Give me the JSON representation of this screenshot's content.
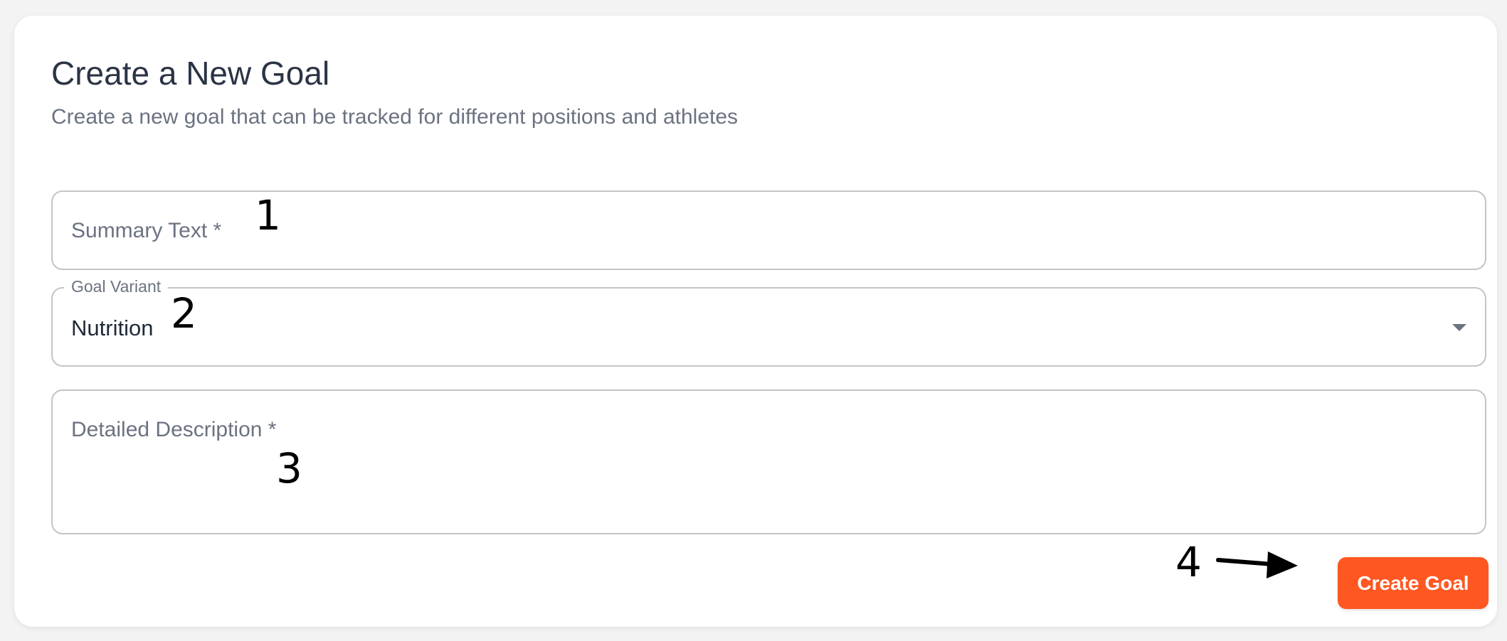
{
  "header": {
    "title": "Create a New Goal",
    "subtitle": "Create a new goal that can be tracked for different positions and athletes"
  },
  "form": {
    "summary": {
      "placeholder": "Summary Text *",
      "value": ""
    },
    "variant": {
      "label": "Goal Variant",
      "value": "Nutrition",
      "icon": "chevron-down-icon"
    },
    "description": {
      "placeholder": "Detailed Description *",
      "value": ""
    },
    "submit_label": "Create Goal"
  },
  "annotations": {
    "n1": "1",
    "n2": "2",
    "n3": "3",
    "n4": "4"
  },
  "colors": {
    "accent": "#fe5722",
    "title": "#2b3445",
    "muted": "#6b7280",
    "border": "#c4c4c4"
  }
}
